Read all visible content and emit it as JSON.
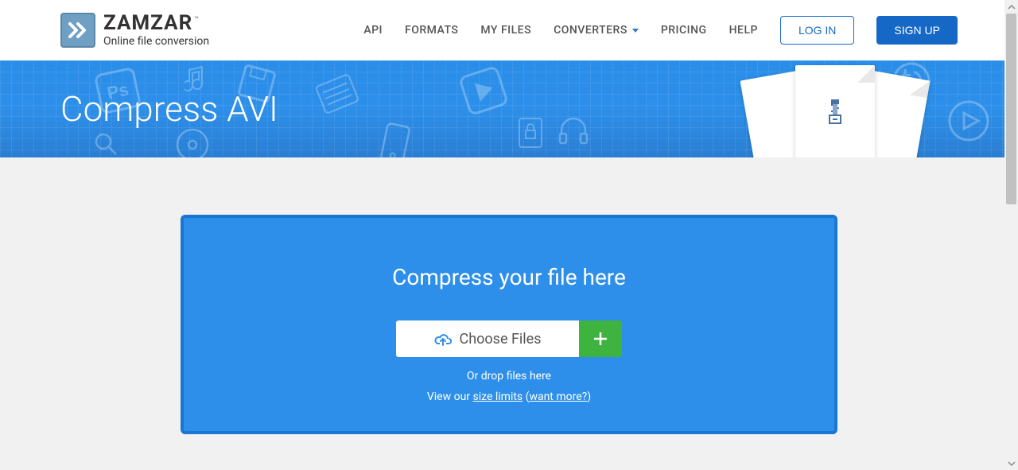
{
  "logo": {
    "main": "ZAMZAR",
    "sub": "Online file conversion",
    "tm": "™"
  },
  "nav": {
    "api": "API",
    "formats": "FORMATS",
    "myfiles": "MY FILES",
    "converters": "CONVERTERS",
    "pricing": "PRICING",
    "help": "HELP",
    "login": "LOG IN",
    "signup": "SIGN UP"
  },
  "hero": {
    "title": "Compress AVI"
  },
  "upload": {
    "title": "Compress your file here",
    "choose": "Choose Files",
    "drop": "Or drop files here",
    "view": "View our ",
    "size_limits": "size limits",
    "open_paren": " (",
    "want_more": "want more?",
    "close_paren": ")"
  }
}
